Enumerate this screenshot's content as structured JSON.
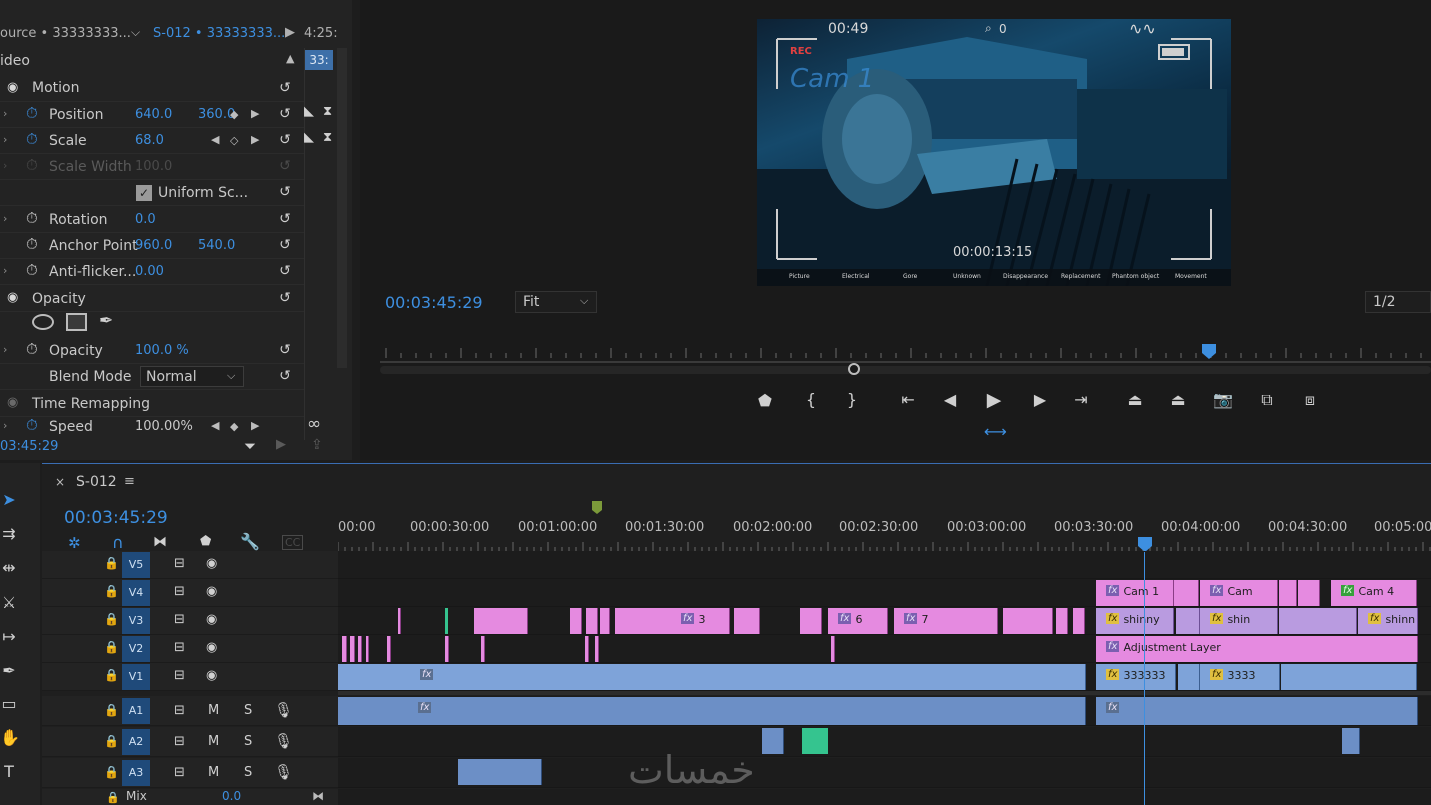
{
  "effect_controls": {
    "source_tab": "ource • 33333333...",
    "active_tab": "S-012 • 33333333...",
    "tab_time": "4:25:",
    "clip_badge": "33:",
    "section_video": "ideo",
    "motion": "Motion",
    "position": {
      "label": "Position",
      "x": "640.0",
      "y": "360.0"
    },
    "scale": {
      "label": "Scale",
      "value": "68.0"
    },
    "scale_width": {
      "label": "Scale Width",
      "value": "100.0"
    },
    "uniform_scale": "Uniform Sc...",
    "rotation": {
      "label": "Rotation",
      "value": "0.0"
    },
    "anchor_point": {
      "label": "Anchor Point",
      "x": "960.0",
      "y": "540.0"
    },
    "anti_flicker": {
      "label": "Anti-flicker...",
      "value": "0.00"
    },
    "opacity_section": "Opacity",
    "opacity": {
      "label": "Opacity",
      "value": "100.0 %"
    },
    "blend_mode": {
      "label": "Blend Mode",
      "value": "Normal"
    },
    "time_remapping": "Time Remapping",
    "speed": {
      "label": "Speed",
      "value": "100.00%"
    },
    "footer_time": "03:45:29"
  },
  "program_monitor": {
    "timecode": "00:03:45:29",
    "fit": "Fit",
    "resolution": "1/2",
    "osd": {
      "time_top": "00:49",
      "counter": "0",
      "rec": "REC",
      "cam": "Cam 1",
      "time_bottom": "00:00:13:15",
      "menu": [
        "Picture",
        "Electrical",
        "Gore",
        "Unknown",
        "Disappearance",
        "Replacement",
        "Phantom object",
        "Movement"
      ]
    }
  },
  "timeline": {
    "sequence_name": "S-012",
    "timecode": "00:03:45:29",
    "ruler": [
      "00:00",
      "00:00:30:00",
      "00:01:00:00",
      "00:01:30:00",
      "00:02:00:00",
      "00:02:30:00",
      "00:03:00:00",
      "00:03:30:00",
      "00:04:00:00",
      "00:04:30:00",
      "00:05:00"
    ],
    "video_tracks": [
      "V5",
      "V4",
      "V3",
      "V2",
      "V1"
    ],
    "audio_tracks": [
      "A1",
      "A2",
      "A3"
    ],
    "mute": "M",
    "solo": "S",
    "mix_label": "Mix",
    "mix_value": "0.0",
    "clip_labels": {
      "v4a": "Cam 1",
      "v4b": "Cam",
      "v4c": "Cam 4",
      "v3a": "3",
      "v3b": "6",
      "v3c": "7",
      "v3d": "shinny",
      "v3e": "shin",
      "v3f": "shinn",
      "v2": "Adjustment Layer",
      "v1a": "333333",
      "v1b": "3333"
    },
    "fx": "fx"
  },
  "watermark": "خمسات",
  "colors": {
    "accent": "#3d8fe0",
    "pink": "#e58ae0",
    "blue": "#7ea3d9",
    "track_name": "#1f4a7a"
  }
}
